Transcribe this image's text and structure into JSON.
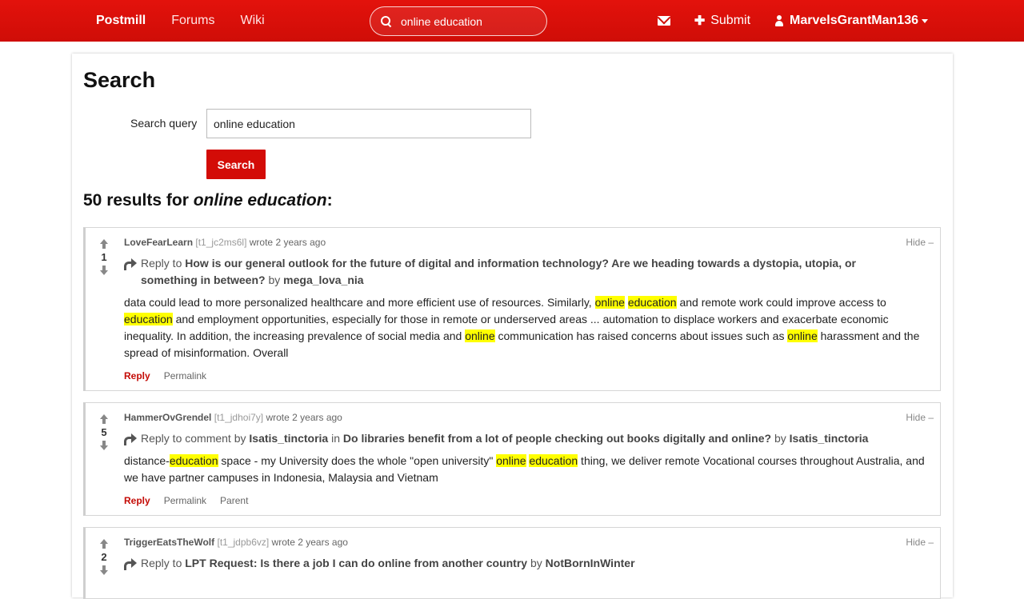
{
  "nav": {
    "brand": "Postmill",
    "links": [
      "Forums",
      "Wiki"
    ],
    "search_value": "online education",
    "submit": "Submit",
    "user": "MarvelsGrantMan136"
  },
  "page": {
    "title": "Search",
    "query_label": "Search query",
    "query_value": "online education",
    "search_button": "Search",
    "results_prefix": "50 results for ",
    "results_query": "online education",
    "results_suffix": ":"
  },
  "results": [
    {
      "author": "LoveFearLearn",
      "id": "[t1_jc2ms6l]",
      "wrote": "wrote 2 years ago",
      "score": "1",
      "hide": "Hide –",
      "reply_prefix": "Reply to ",
      "reply_title": "How is our general outlook for the future of digital and information technology? Are we heading towards a dystopia, utopia, or something in between?",
      "reply_by": " by ",
      "reply_user": "mega_lova_nia",
      "actions": [
        "Reply",
        "Permalink"
      ]
    },
    {
      "author": "HammerOvGrendel",
      "id": "[t1_jdhoi7y]",
      "wrote": "wrote 2 years ago",
      "score": "5",
      "hide": "Hide –",
      "reply_prefix": "Reply to comment by ",
      "reply_comment_user": "Isatis_tinctoria",
      "reply_in": " in ",
      "reply_title": "Do libraries benefit from a lot of people checking out books digitally and online?",
      "reply_by": " by ",
      "reply_user": "Isatis_tinctoria",
      "actions": [
        "Reply",
        "Permalink",
        "Parent"
      ]
    },
    {
      "author": "TriggerEatsTheWolf",
      "id": "[t1_jdpb6vz]",
      "wrote": "wrote 2 years ago",
      "score": "2",
      "hide": "Hide –",
      "reply_prefix": "Reply to ",
      "reply_title": "LPT Request: Is there a job I can do online from another country",
      "reply_by": " by ",
      "reply_user": "NotBornInWinter"
    }
  ],
  "body1": {
    "a": "data could lead to more personalized healthcare and more efficient use of resources. Similarly, ",
    "h1": "online",
    "s1": " ",
    "h2": "education",
    "b": " and remote work could improve access to ",
    "h3": "education",
    "c": " and employment opportunities, especially for those in remote or underserved areas ... automation to displace workers and exacerbate economic inequality. In addition, the increasing prevalence of social media and ",
    "h4": "online",
    "d": " communication has raised concerns about issues such as ",
    "h5": "online",
    "e": " harassment and the spread of misinformation. Overall"
  },
  "body2": {
    "a": "distance-",
    "h1": "education",
    "b": " space - my University does the whole \"open university\" ",
    "h2": "online",
    "s1": " ",
    "h3": "education",
    "c": " thing, we deliver remote Vocational courses throughout Australia, and we have partner campuses in Indonesia, Malaysia and Vietnam"
  }
}
